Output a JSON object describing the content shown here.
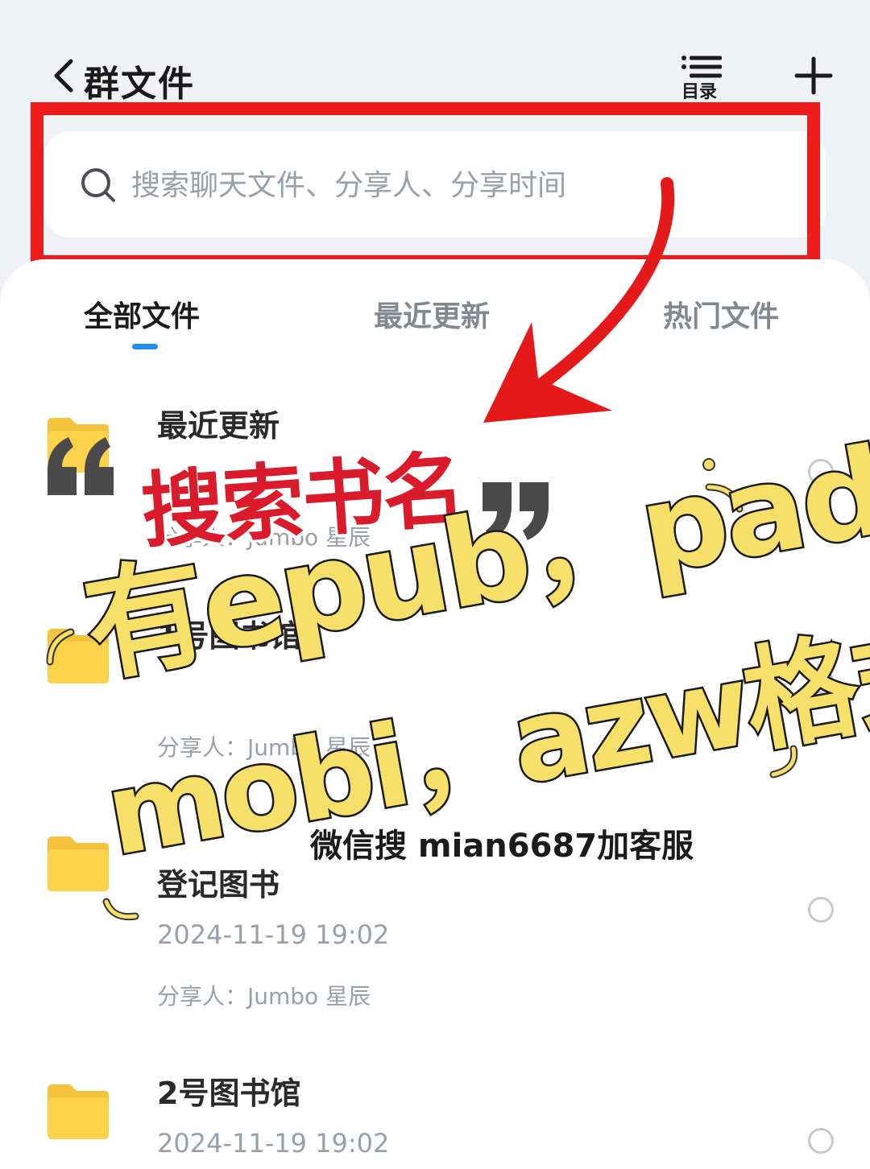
{
  "header": {
    "back_label": "",
    "title": "群文件",
    "toc_label": "目录"
  },
  "search": {
    "placeholder": "搜索聊天文件、分享人、分享时间"
  },
  "tabs": [
    {
      "label": "全部文件",
      "active": true
    },
    {
      "label": "最近更新",
      "active": false
    },
    {
      "label": "热门文件",
      "active": false
    }
  ],
  "files": [
    {
      "title": "最近更新",
      "date": "",
      "sharer": "分享人：Jumbo 星辰"
    },
    {
      "title": "1号图书馆",
      "date": "",
      "sharer": "分享人：Jumbo 星辰"
    },
    {
      "title": "登记图书",
      "date": "2024-11-19 19:02",
      "sharer": "分享人：Jumbo 星辰"
    },
    {
      "title": "2号图书馆",
      "date": "2024-11-19 19:02",
      "sharer": ""
    }
  ],
  "overlay": {
    "caption_red": "搜索书名",
    "caption_line1": "有epub，pad，",
    "caption_line2": "mobi，azw格式",
    "promo_text": "微信搜 mian6687加客服"
  },
  "colors": {
    "accent": "#1e8ff0",
    "highlight_box": "#ee1b1b",
    "caption_red": "#d91b2b",
    "caption_yellow": "#f7e06a",
    "folder": "#fbd34a"
  }
}
